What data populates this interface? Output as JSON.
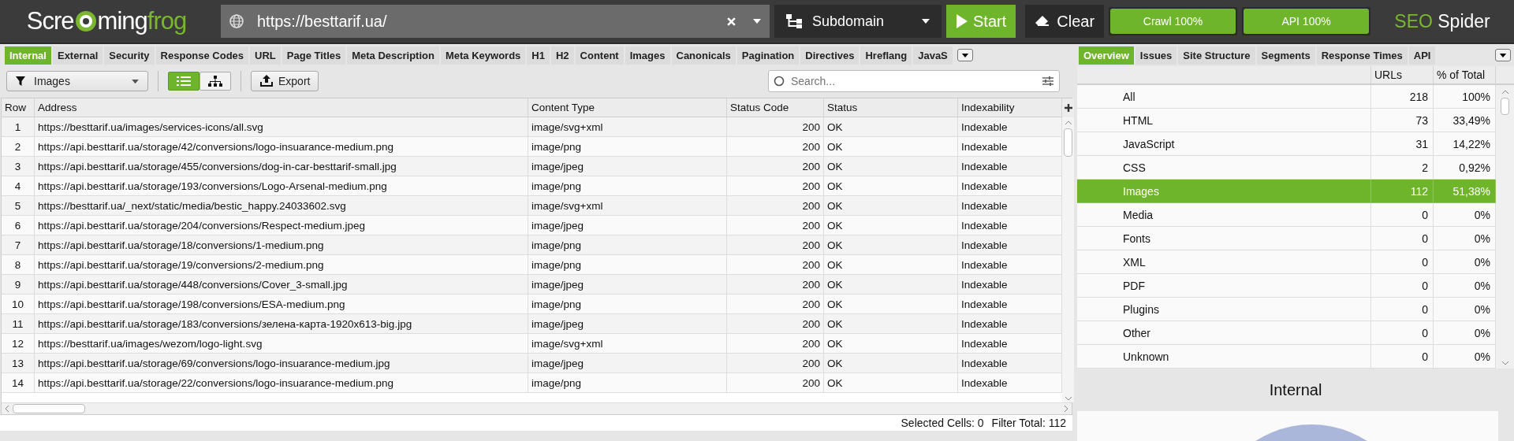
{
  "topbar": {
    "logo": {
      "start": "Scre",
      "middle": "ming",
      "end": "frog"
    },
    "url": "https://besttarif.ua/",
    "mode": "Subdomain",
    "start": "Start",
    "clear": "Clear",
    "progress": [
      {
        "label": "Crawl 100%",
        "level": 1
      },
      {
        "label": "API 100%",
        "level": 1
      }
    ],
    "brand": {
      "first": "SEO",
      "second": "Spider"
    }
  },
  "left_tabs": [
    {
      "label": "Internal",
      "selected": true
    },
    {
      "label": "External",
      "selected": false
    },
    {
      "label": "Security",
      "selected": false
    },
    {
      "label": "Response Codes",
      "selected": false
    },
    {
      "label": "URL",
      "selected": false
    },
    {
      "label": "Page Titles",
      "selected": false
    },
    {
      "label": "Meta Description",
      "selected": false
    },
    {
      "label": "Meta Keywords",
      "selected": false
    },
    {
      "label": "H1",
      "selected": false
    },
    {
      "label": "H2",
      "selected": false
    },
    {
      "label": "Content",
      "selected": false
    },
    {
      "label": "Images",
      "selected": false
    },
    {
      "label": "Canonicals",
      "selected": false
    },
    {
      "label": "Pagination",
      "selected": false
    },
    {
      "label": "Directives",
      "selected": false
    },
    {
      "label": "Hreflang",
      "selected": false
    },
    {
      "label": "JavaS",
      "selected": false
    }
  ],
  "toolbar": {
    "filter": "Images",
    "view_modes": [
      {
        "kind": "list",
        "selected": true
      },
      {
        "kind": "tree",
        "selected": false
      }
    ],
    "export": "Export",
    "search": {
      "placeholder": "Search..."
    }
  },
  "table": {
    "columns": [
      "Row",
      "Address",
      "Content Type",
      "Status Code",
      "Status",
      "Indexability"
    ],
    "rows": [
      [
        "1",
        "https://besttarif.ua/images/services-icons/all.svg",
        "image/svg+xml",
        "200",
        "OK",
        "Indexable"
      ],
      [
        "2",
        "https://api.besttarif.ua/storage/42/conversions/logo-insuarance-medium.png",
        "image/png",
        "200",
        "OK",
        "Indexable"
      ],
      [
        "3",
        "https://api.besttarif.ua/storage/455/conversions/dog-in-car-besttarif-small.jpg",
        "image/jpeg",
        "200",
        "OK",
        "Indexable"
      ],
      [
        "4",
        "https://api.besttarif.ua/storage/193/conversions/Logo-Arsenal-medium.png",
        "image/png",
        "200",
        "OK",
        "Indexable"
      ],
      [
        "5",
        "https://besttarif.ua/_next/static/media/bestic_happy.24033602.svg",
        "image/svg+xml",
        "200",
        "OK",
        "Indexable"
      ],
      [
        "6",
        "https://api.besttarif.ua/storage/204/conversions/Respect-medium.jpeg",
        "image/jpeg",
        "200",
        "OK",
        "Indexable"
      ],
      [
        "7",
        "https://api.besttarif.ua/storage/18/conversions/1-medium.png",
        "image/png",
        "200",
        "OK",
        "Indexable"
      ],
      [
        "8",
        "https://api.besttarif.ua/storage/19/conversions/2-medium.png",
        "image/png",
        "200",
        "OK",
        "Indexable"
      ],
      [
        "9",
        "https://api.besttarif.ua/storage/448/conversions/Cover_3-small.jpg",
        "image/jpeg",
        "200",
        "OK",
        "Indexable"
      ],
      [
        "10",
        "https://api.besttarif.ua/storage/198/conversions/ESA-medium.png",
        "image/png",
        "200",
        "OK",
        "Indexable"
      ],
      [
        "11",
        "https://api.besttarif.ua/storage/183/conversions/зелена-карта-1920x613-big.jpg",
        "image/jpeg",
        "200",
        "OK",
        "Indexable"
      ],
      [
        "12",
        "https://besttarif.ua/images/wezom/logo-light.svg",
        "image/svg+xml",
        "200",
        "OK",
        "Indexable"
      ],
      [
        "13",
        "https://api.besttarif.ua/storage/69/conversions/logo-insuarance-medium.jpg",
        "image/jpeg",
        "200",
        "OK",
        "Indexable"
      ],
      [
        "14",
        "https://api.besttarif.ua/storage/22/conversions/logo-insuarance-medium.png",
        "image/png",
        "200",
        "OK",
        "Indexable"
      ]
    ]
  },
  "status_bar": {
    "selected_label": "Selected Cells:",
    "selected_value": "0",
    "filter_label": "Filter Total:",
    "filter_value": "112"
  },
  "right_tabs": [
    {
      "label": "Overview",
      "selected": true
    },
    {
      "label": "Issues",
      "selected": false
    },
    {
      "label": "Site Structure",
      "selected": false
    },
    {
      "label": "Segments",
      "selected": false
    },
    {
      "label": "Response Times",
      "selected": false
    },
    {
      "label": "API",
      "selected": false
    }
  ],
  "overview": {
    "columns": [
      "URLs",
      "% of Total"
    ],
    "rows": [
      {
        "label": "All",
        "urls": "218",
        "percent": "100%",
        "selected": false
      },
      {
        "label": "HTML",
        "urls": "73",
        "percent": "33,49%",
        "selected": false
      },
      {
        "label": "JavaScript",
        "urls": "31",
        "percent": "14,22%",
        "selected": false
      },
      {
        "label": "CSS",
        "urls": "2",
        "percent": "0,92%",
        "selected": false
      },
      {
        "label": "Images",
        "urls": "112",
        "percent": "51,38%",
        "selected": true
      },
      {
        "label": "Media",
        "urls": "0",
        "percent": "0%",
        "selected": false
      },
      {
        "label": "Fonts",
        "urls": "0",
        "percent": "0%",
        "selected": false
      },
      {
        "label": "XML",
        "urls": "0",
        "percent": "0%",
        "selected": false
      },
      {
        "label": "PDF",
        "urls": "0",
        "percent": "0%",
        "selected": false
      },
      {
        "label": "Plugins",
        "urls": "0",
        "percent": "0%",
        "selected": false
      },
      {
        "label": "Other",
        "urls": "0",
        "percent": "0%",
        "selected": false
      },
      {
        "label": "Unknown",
        "urls": "0",
        "percent": "0%",
        "selected": false
      }
    ],
    "chart_title": "Internal"
  }
}
